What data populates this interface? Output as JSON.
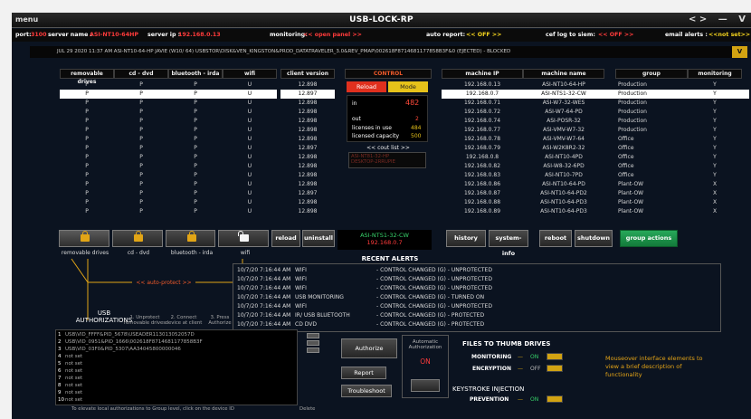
{
  "app": {
    "title": "USB-LOCK-RP",
    "menu_label": "menu",
    "controls": {
      "nav": "< >",
      "minimize": "—",
      "maximize": "V"
    }
  },
  "status_bar": {
    "port_label": "port:",
    "port_value": "3100",
    "server_name_label": "server name :",
    "server_name_value": "ASI-NT10-64HP",
    "server_ip_label": "server ip :",
    "server_ip_value": "192.168.0.13",
    "monitoring_label": "monitoring:",
    "monitoring_value": "<< open panel >>",
    "auto_report_label": "auto report:",
    "auto_report_value": "<< OFF >>",
    "cef_label": "cef log to siem:",
    "cef_value": "<< OFF >>",
    "email_label": "email alerts :",
    "email_value": "<<not set>>"
  },
  "banner": {
    "text": "JUL  29  2020   11:37 AM  ASI-NT10-64-HP  JAVIE  (W10/ 64) USBSTOR\\DISK&VEN_KINGSTON&PROD_DATATRAVELER_3.0&REV_PMAP\\002618F8714681177858B3F&0  (EJECTED) - BLOCKED",
    "button": "V"
  },
  "device_table": {
    "headers": [
      "removable drives",
      "cd - dvd",
      "bluetooth - irda",
      "wifi"
    ],
    "rows": [
      [
        "P",
        "P",
        "P",
        "U"
      ],
      [
        "P",
        "P",
        "P",
        "U"
      ],
      [
        "P",
        "P",
        "P",
        "U"
      ],
      [
        "P",
        "P",
        "P",
        "U"
      ],
      [
        "P",
        "P",
        "P",
        "U"
      ],
      [
        "P",
        "P",
        "P",
        "U"
      ],
      [
        "P",
        "P",
        "P",
        "U"
      ],
      [
        "P",
        "P",
        "P",
        "U"
      ],
      [
        "P",
        "P",
        "P",
        "U"
      ],
      [
        "P",
        "P",
        "P",
        "U"
      ],
      [
        "P",
        "P",
        "P",
        "U"
      ],
      [
        "P",
        "P",
        "P",
        "U"
      ],
      [
        "P",
        "P",
        "P",
        "U"
      ],
      [
        "P",
        "P",
        "P",
        "U"
      ],
      [
        "P",
        "P",
        "P",
        "U"
      ]
    ]
  },
  "client_version": {
    "header": "client version",
    "values": [
      "12.898",
      "12.897",
      "12.898",
      "12.898",
      "12.898",
      "12.898",
      "12.898",
      "12.897",
      "12.898",
      "12.898",
      "12.898",
      "12.898",
      "12.897",
      "12.898",
      "12.898"
    ]
  },
  "control": {
    "header": "CONTROL",
    "reload_label": "Reload",
    "mode_label": "Mode",
    "in_label": "in",
    "in_value": "482",
    "out_label": "out",
    "out_value": "2",
    "licenses_label": "licenses in use",
    "licenses_value": "484",
    "capacity_label": "licensed capacity",
    "capacity_value": "500",
    "cout_list": "<< cout list >>",
    "cout_items": [
      "ASI-NT81-32-HP",
      "DESKTOP-2RRUPIE"
    ]
  },
  "machines": {
    "headers": [
      "machine IP",
      "machine name",
      "group",
      "monitoring"
    ],
    "rows": [
      [
        "192.168.0.13",
        "ASI-NT10-64-HP",
        "Production",
        "Y"
      ],
      [
        "192.168.0.7",
        "ASI-NTS1-32-CW",
        "Production",
        "Y"
      ],
      [
        "192.168.0.71",
        "ASI-W7-32-WES",
        "Production",
        "Y"
      ],
      [
        "192.168.0.72",
        "ASI-W7-64-PD",
        "Production",
        "Y"
      ],
      [
        "192.168.0.74",
        "ASI-POSR-32",
        "Production",
        "Y"
      ],
      [
        "192.168.0.77",
        "ASI-VMV-W7-32",
        "Production",
        "Y"
      ],
      [
        "192.168.0.78",
        "ASI-VMV-W7-64",
        "Office",
        "Y"
      ],
      [
        "192.168.0.79",
        "ASI-W2K8R2-32",
        "Office",
        "Y"
      ],
      [
        "192.168.0.8",
        "ASI-NT10-4PD",
        "Office",
        "Y"
      ],
      [
        "192.168.0.82",
        "ASI-W8-32-6PD",
        "Office",
        "Y"
      ],
      [
        "192.168.0.83",
        "ASI-NT10-7PD",
        "Office",
        "Y"
      ],
      [
        "192.168.0.86",
        "ASI-NT10-64-PD",
        "Plant-OW",
        "X"
      ],
      [
        "192.168.0.87",
        "ASI-NT10-64-PD2",
        "Plant-OW",
        "X"
      ],
      [
        "192.168.0.88",
        "ASI-NT10-64-PD3",
        "Plant-OW",
        "X"
      ],
      [
        "192.168.0.89",
        "ASI-NT10-64-PD3",
        "Plant-OW",
        "X"
      ]
    ]
  },
  "selected_machine": {
    "name": "ASI-NTS1-32-CW",
    "ip": "192.168.0.7"
  },
  "action_buttons": {
    "reload": "reload",
    "uninstall": "uninstall",
    "history": "history",
    "system_info": "system-info",
    "reboot": "reboot",
    "shutdown": "shutdown",
    "group_actions": "group actions"
  },
  "locks": {
    "labels": [
      "removable drives",
      "cd - dvd",
      "bluetooth - irda",
      "wifi"
    ],
    "auto_protect": "<< auto-protect >>"
  },
  "usb_auth": {
    "title": "USB\nAUTHORIZATIONS",
    "step1": "1. Unprotect\nremovable drives",
    "step2": "2. Connect\ndevice at client",
    "step3": "3. Press\nAuthorize",
    "list": [
      "USB\\VID_FFFF&PID_5678\\USEADER113013052057D",
      "USB\\VID_0951&PID_1666\\002618F8714681177858B3F",
      "USB\\VID_03F0&PID_5307\\AA34045800000046",
      "not set",
      "not set",
      "not set",
      "not set",
      "not set",
      "not set",
      "not set"
    ],
    "footer": "To elevate local authorizations to Group level, click on the device ID",
    "delete_label": "Delete"
  },
  "recent_alerts": {
    "title": "RECENT ALERTS",
    "rows": [
      [
        "10/7/20 7:16:44 AM",
        "WIFI",
        "- CONTROL CHANGED (G) -  UNPROTECTED"
      ],
      [
        "10/7/20 7:16:44 AM",
        "WIFI",
        "- CONTROL CHANGED (G) -  UNPROTECTED"
      ],
      [
        "10/7/20 7:16:44 AM",
        "WIFI",
        "- CONTROL CHANGED (G) -  UNPROTECTED"
      ],
      [
        "10/7/20 7:16:44 AM",
        "USB MONITORING",
        "- CONTROL CHANGED (G) -  TURNED ON"
      ],
      [
        "10/7/20 7:16:44 AM",
        "WIFI",
        "- CONTROL CHANGED (G) -  UNPROTECTED"
      ],
      [
        "10/7/20 7:16:44 AM",
        "IR/ USB BLUETOOTH",
        "- CONTROL CHANGED (G) -  PROTECTED"
      ],
      [
        "10/7/20 7:16:44 AM",
        "CD  DVD",
        "- CONTROL CHANGED (G) -  PROTECTED"
      ]
    ]
  },
  "authorize_panel": {
    "authorize": "Authorize",
    "report": "Report",
    "troubleshoot": "Troubleshoot",
    "auto_auth_title": "Automatic\nAuthorization",
    "auto_auth_value": "ON"
  },
  "thumb_drives": {
    "title": "FILES TO THUMB DRIVES",
    "monitoring_label": "MONITORING",
    "monitoring_value": "ON",
    "encryption_label": "ENCRYPTION",
    "encryption_value": "OFF",
    "keystroke_title": "KEYSTROKE INJECTION",
    "prevention_label": "PREVENTION",
    "prevention_value": "ON"
  },
  "help_text": "Mouseover interface elements to view a brief description of functionality",
  "colors": {
    "background": "#0b1320",
    "accent_gold": "#d2a312",
    "alert_red": "#ff3b3b",
    "ok_green": "#37d26a",
    "lock_orange": "#c9860c"
  }
}
